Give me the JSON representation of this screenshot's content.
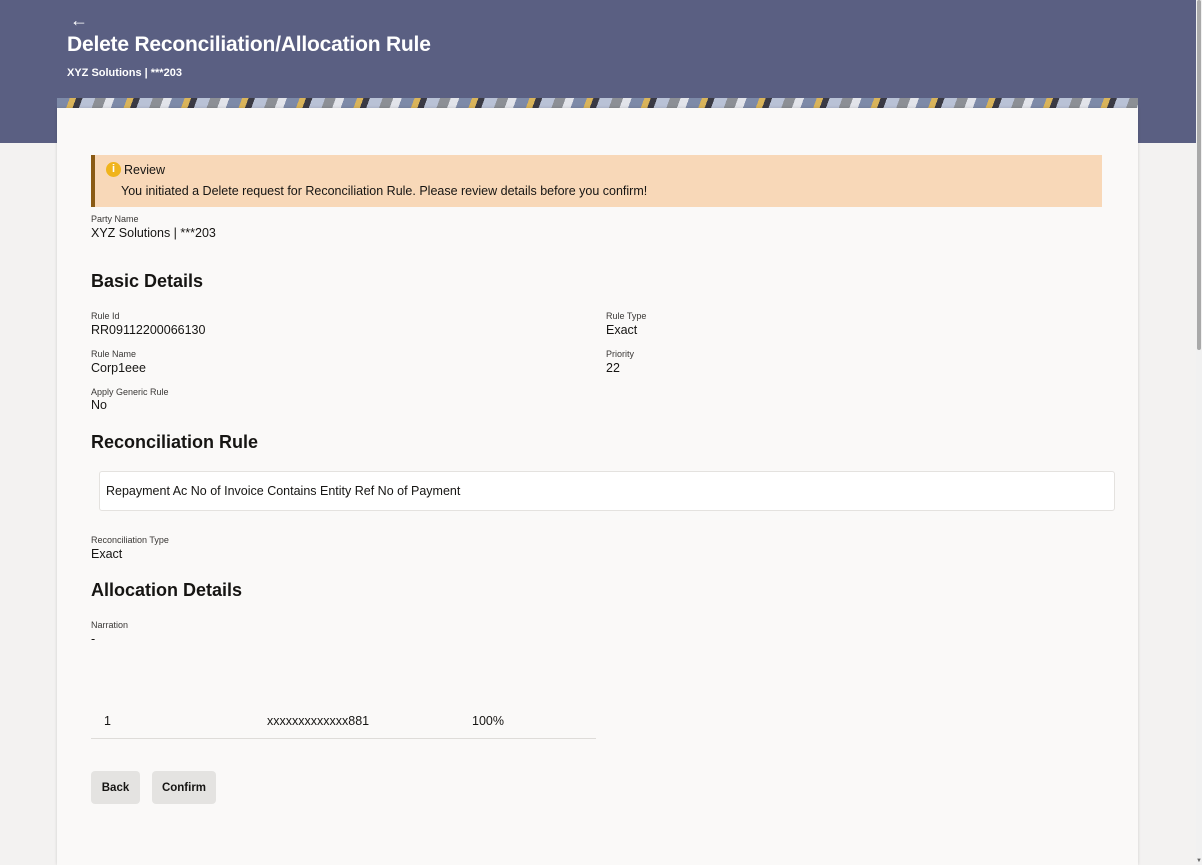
{
  "header": {
    "back_icon": "arrow-left-icon",
    "title": "Delete Reconciliation/Allocation Rule",
    "subtitle": "XYZ Solutions | ***203",
    "band_color": "#5a5f82"
  },
  "review": {
    "icon": "info-icon",
    "title": "Review",
    "message": "You initiated a Delete request for Reconciliation Rule. Please review details before you confirm!",
    "background_color": "#f8d8b8",
    "accent_color": "#8a5a14"
  },
  "party": {
    "label": "Party Name",
    "value": "XYZ Solutions | ***203"
  },
  "basic_details": {
    "title": "Basic Details",
    "rule_id": {
      "label": "Rule Id",
      "value": "RR09112200066130"
    },
    "rule_type": {
      "label": "Rule Type",
      "value": "Exact"
    },
    "rule_name": {
      "label": "Rule Name",
      "value": "Corp1eee"
    },
    "priority": {
      "label": "Priority",
      "value": "22"
    },
    "apply_generic_rule": {
      "label": "Apply Generic Rule",
      "value": "No"
    }
  },
  "reconciliation_rule": {
    "title": "Reconciliation Rule",
    "rule_text": "Repayment Ac No of Invoice Contains Entity Ref No of Payment",
    "type": {
      "label": "Reconciliation Type",
      "value": "Exact"
    }
  },
  "allocation_details": {
    "title": "Allocation Details",
    "narration": {
      "label": "Narration",
      "value": "-"
    },
    "rows": [
      {
        "sequence": "1",
        "account": "xxxxxxxxxxxxx881",
        "percentage": "100%"
      }
    ]
  },
  "actions": {
    "back_label": "Back",
    "confirm_label": "Confirm"
  }
}
